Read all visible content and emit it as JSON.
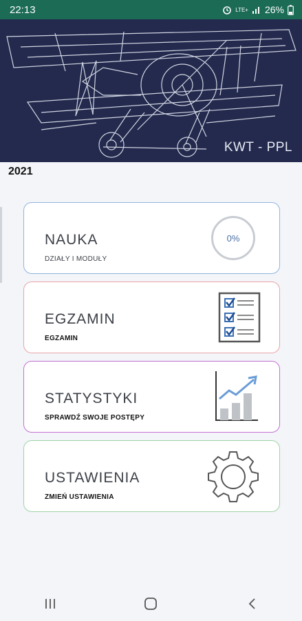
{
  "status_bar": {
    "time": "22:13",
    "network": "LTE+",
    "battery": "26%"
  },
  "header": {
    "app_title": "KWT - PPL"
  },
  "year": "2021",
  "cards": [
    {
      "title": "NAUKA",
      "subtitle": "DZIAŁY I MODUŁY",
      "border_color": "#8fb3e0",
      "icon": "progress-ring-icon",
      "progress": "0%"
    },
    {
      "title": "EGZAMIN",
      "subtitle": "EGZAMIN",
      "border_color": "#e8a3a8",
      "icon": "checklist-icon"
    },
    {
      "title": "STATYSTYKI",
      "subtitle": "SPRAWDŹ SWOJE POSTĘPY",
      "border_color": "#c46fd3",
      "icon": "bar-chart-trend-icon"
    },
    {
      "title": "USTAWIENIA",
      "subtitle": "ZMIEŃ USTAWIENIA",
      "border_color": "#9fd3a6",
      "icon": "gear-icon"
    }
  ],
  "nav": {
    "recents_icon": "recents-icon",
    "home_icon": "home-icon",
    "back_icon": "back-icon"
  }
}
